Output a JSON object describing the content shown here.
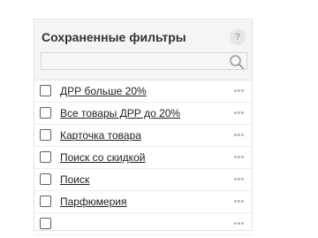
{
  "panel": {
    "title": "Сохраненные фильтры",
    "help_label": "?",
    "search": {
      "value": "",
      "placeholder": ""
    },
    "filters": [
      {
        "label": "ДРР больше 20%",
        "checked": false
      },
      {
        "label": "Все товары ДРР до 20%",
        "checked": false
      },
      {
        "label": "Карточка товара",
        "checked": false
      },
      {
        "label": "Поиск со скидкой",
        "checked": false
      },
      {
        "label": "Поиск",
        "checked": false
      },
      {
        "label": "Парфюмерия",
        "checked": false
      },
      {
        "label": "",
        "checked": false
      }
    ]
  },
  "colors": {
    "header_bg": "#f5f5f5",
    "border": "#e3e3e3",
    "text": "#222222",
    "icon_gray": "#b4b4b4"
  },
  "icons": {
    "help": "help-icon",
    "search": "search-icon",
    "row_menu": "more-icon"
  }
}
